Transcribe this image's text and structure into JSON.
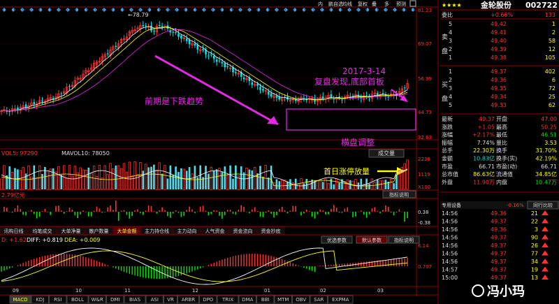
{
  "toolbar": {
    "buttons": [
      "内",
      "鹏自选",
      "均线",
      "复权",
      "叠",
      "多",
      "预测"
    ]
  },
  "stock": {
    "stars": "★★★★",
    "name": "金轮股份",
    "code": "002722"
  },
  "order_book": {
    "weibi_label": "委比",
    "weibi_value": "+0.66%",
    "weibi_diff": "133",
    "sell_label": "卖盘",
    "buy_label": "买盘",
    "sells": [
      {
        "level": "5",
        "price": "49.42",
        "vol": "1"
      },
      {
        "level": "4",
        "price": "49.41",
        "vol": "2"
      },
      {
        "level": "3",
        "price": "49.40",
        "vol": "58"
      },
      {
        "level": "2",
        "price": "49.39",
        "vol": "12"
      },
      {
        "level": "1",
        "price": "49.38",
        "vol": "105"
      }
    ],
    "buys": [
      {
        "level": "1",
        "price": "49.37",
        "vol": "402"
      },
      {
        "level": "2",
        "price": "49.36",
        "vol": "6"
      },
      {
        "level": "3",
        "price": "49.35",
        "vol": "72"
      },
      {
        "level": "4",
        "price": "49.34",
        "vol": "25"
      },
      {
        "level": "5",
        "price": "49.33",
        "vol": "62"
      }
    ]
  },
  "stats": [
    {
      "k1": "最新",
      "v1": "49.37",
      "k2": "开盘",
      "v2": "47.00",
      "c1": "#ff3232",
      "c2": "#ff3232"
    },
    {
      "k1": "涨跌",
      "v1": "+1.05",
      "k2": "最高",
      "v2": "50.25",
      "c1": "#ff3232",
      "c2": "#ff3232"
    },
    {
      "k1": "涨幅",
      "v1": "+2.17%",
      "k2": "最低",
      "v2": "46.51",
      "c1": "#ff3232",
      "c2": "#00e600"
    },
    {
      "k1": "振幅",
      "v1": "7.74%",
      "k2": "量比",
      "v2": "3.53",
      "c1": "#dddddd",
      "c2": "#ffff00"
    },
    {
      "k1": "总手",
      "v1": "22.30万",
      "k2": "换手",
      "v2": "31.70%",
      "c1": "#ffff00",
      "c2": "#ffff00"
    },
    {
      "k1": "金额",
      "v1": "10.83亿",
      "k2": "换手(实)",
      "v2": "42.19%",
      "c1": "#00e6e6",
      "c2": "#ffff00"
    },
    {
      "k1": "市盈",
      "v1": "66.71",
      "k2": "市盈(动)",
      "v2": "66.71",
      "c1": "#dddddd",
      "c2": "#dddddd"
    },
    {
      "k1": "总市值",
      "v1": "86.63亿",
      "k2": "流通值",
      "v2": "34.85亿",
      "c1": "#ffff00",
      "c2": "#ffff00"
    },
    {
      "k1": "外盘",
      "v1": "11.90万",
      "k2": "内盘",
      "v2": "10.47万",
      "c1": "#ff3232",
      "c2": "#00e600"
    }
  ],
  "ticks_header": {
    "left": "专用设备",
    "mid": "-0.16%",
    "right": "同行比较"
  },
  "ticks": [
    {
      "time": "14:56",
      "price": "49.36",
      "vol": "21"
    },
    {
      "time": "14:56",
      "price": "49.37",
      "vol": "22"
    },
    {
      "time": "14:56",
      "price": "49.36",
      "vol": "3"
    },
    {
      "time": "14:56",
      "price": "49.37",
      "vol": "90"
    },
    {
      "time": "14:56",
      "price": "49.37",
      "vol": "26"
    },
    {
      "time": "14:56",
      "price": "49.37",
      "vol": "77"
    },
    {
      "time": "14:56",
      "price": "49.37",
      "vol": "34"
    },
    {
      "time": "14:57",
      "price": "49.37",
      "vol": "19"
    },
    {
      "time": "15:00",
      "price": "49.37",
      "vol": "13"
    }
  ],
  "chart": {
    "price_ticks": [
      "81.23",
      "69.07",
      "56.99",
      "44.73",
      "32.63"
    ],
    "high_label": "78.79",
    "vol_label": "VOL5: 97290",
    "mavol_label": "MAVOL10: 78050",
    "vol_button": "成交量",
    "vol_ticks": [
      "2238",
      "1119",
      "X100"
    ],
    "ind_label": "2.79亿元",
    "ind_button": "指标说明",
    "ind_ticks": [
      "0.38",
      "-0.38"
    ],
    "ind_tabs": [
      "讯构日线",
      "均笔成交",
      "大单净量",
      "散户数量",
      "大单金额",
      "主力持仓线",
      "主力动向",
      "人气资金",
      "资金流向",
      "资金抄底"
    ],
    "macd_labels": [
      "D: +1.62",
      "DIFF: +0.819",
      "DEA: +0.009"
    ],
    "macd_buttons": [
      "优选参数",
      "默认参数",
      "指标说明"
    ],
    "macd_ticks": [
      "6.14",
      "0.707"
    ],
    "months": [
      "09",
      "10",
      "11",
      "12",
      "01",
      "02",
      "03"
    ],
    "annotations": {
      "date": "2017-3-14",
      "finding": "复盘发现,底部首板",
      "trend": "前期是下跌趋势",
      "consolidation": "横盘调整",
      "first_limit": "首日涨停放量"
    }
  },
  "bottom_tabs": [
    "MACD",
    "KDJ",
    "RSI",
    "BOLL",
    "W&R",
    "DMI",
    "BIAS",
    "ASI",
    "VR",
    "ARBR",
    "DPO",
    "TRIX",
    "DMA",
    "BBI",
    "MTM",
    "OBV",
    "SAR",
    "EXPMA"
  ],
  "watermark": "冯小玛"
}
